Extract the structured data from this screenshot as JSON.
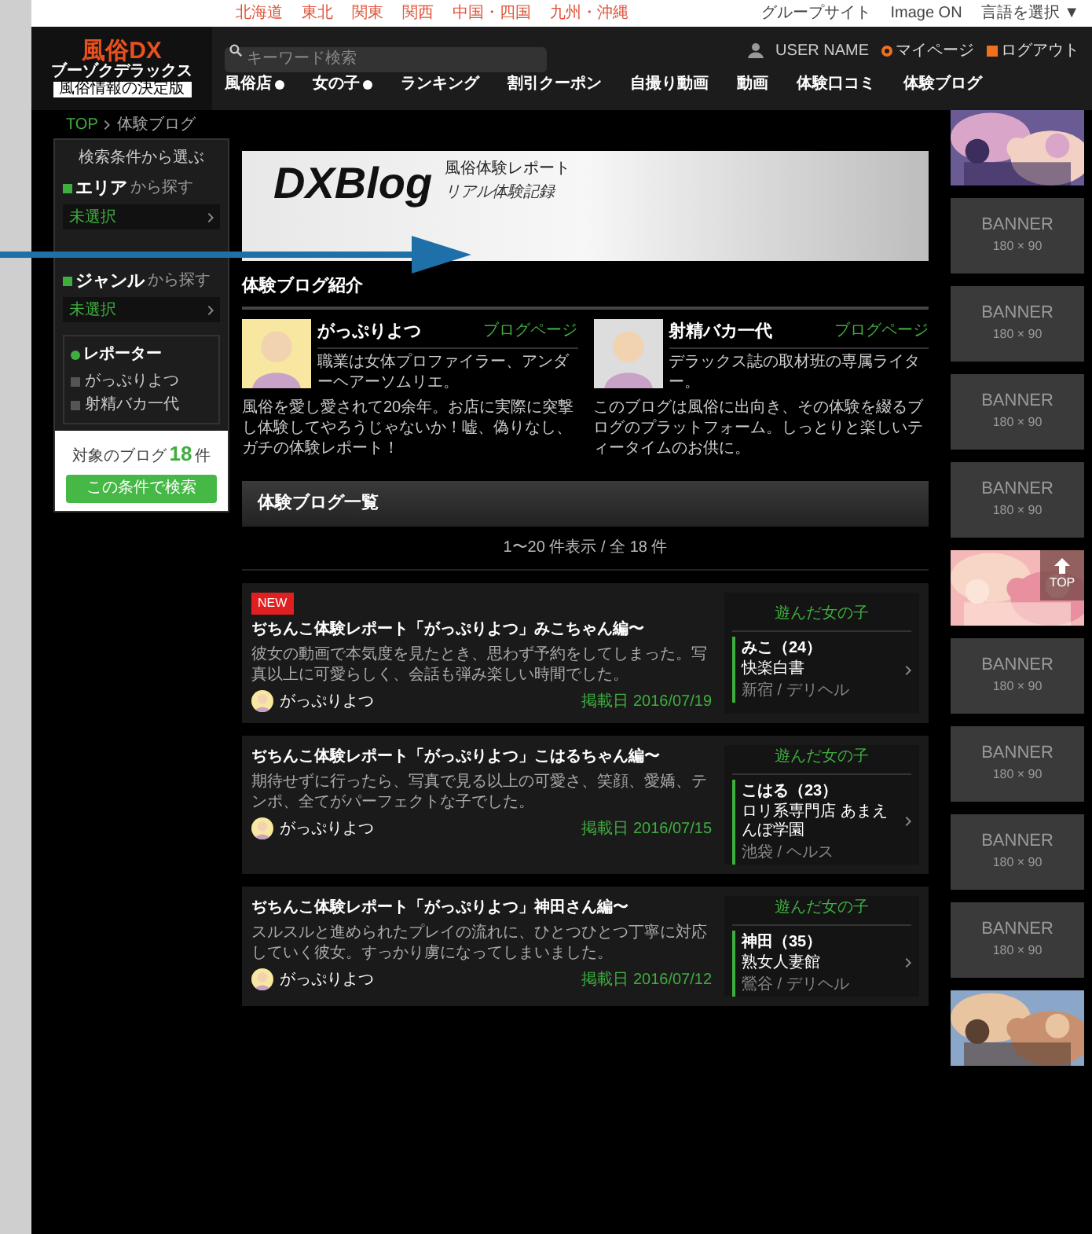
{
  "top_links": [
    "北海道",
    "東北",
    "関東",
    "関西",
    "中国・四国",
    "九州・沖縄"
  ],
  "top_right": [
    "グループサイト",
    "Image ON",
    "言語を選択 ▼"
  ],
  "logo": {
    "main": "風俗DX",
    "sub": "ブーゾクデラックス",
    "tag": "風俗情報の決定版"
  },
  "search": {
    "placeholder": "キーワード検索"
  },
  "user": {
    "name": "USER NAME",
    "links": [
      "マイページ",
      "ログアウト"
    ]
  },
  "nav": [
    {
      "label": "風俗店",
      "badge": true
    },
    {
      "label": "女の子",
      "badge": true
    },
    {
      "label": "ランキング",
      "badge": false
    },
    {
      "label": "割引クーポン",
      "badge": false
    },
    {
      "label": "自撮り動画",
      "badge": false
    },
    {
      "label": "動画",
      "badge": false
    },
    {
      "label": "体験口コミ",
      "badge": false
    },
    {
      "label": "体験ブログ",
      "badge": false
    }
  ],
  "breadcrumb": [
    "TOP",
    "体験ブログ"
  ],
  "sidebar": {
    "title": "検索条件から選ぶ",
    "filters": [
      {
        "label": "エリア",
        "suffix": "から探す",
        "value": "未選択"
      },
      {
        "label": "ジャンル",
        "suffix": "から探す",
        "value": "未選択"
      }
    ],
    "reporter_title": "レポーター",
    "reporters": [
      {
        "label": "がっぷりよつ",
        "checked": false
      },
      {
        "label": "射精バカ一代",
        "checked": false
      }
    ],
    "count_label": "対象のブログ",
    "count": "18",
    "count_unit": "件",
    "button": "この条件で検索"
  },
  "hero": {
    "logo": "DXBlog",
    "subtitle": "風俗体験レポート",
    "tagline": "リアル体験記録"
  },
  "intro": {
    "title": "体験ブログ紹介",
    "reporters": [
      {
        "name": "がっぷりよつ",
        "link": "ブログページ",
        "bio": "職業は女体プロファイラー、アンダーヘアーソムリエ。",
        "text": "風俗を愛し愛されて20余年。お店に実際に突撃し体験してやろうじゃないか！嘘、偽りなし、ガチの体験レポート！"
      },
      {
        "name": "射精バカ一代",
        "link": "ブログページ",
        "bio": "デラックス誌の取材班の専属ライター。",
        "text": "このブログは風俗に出向き、その体験を綴るブログのプラットフォーム。しっとりと楽しいティータイムのお供に。"
      }
    ]
  },
  "list": {
    "title": "体験ブログ一覧",
    "range": "1〜20 件表示 / 全 18 件",
    "posts": [
      {
        "badge": "NEW",
        "title": "ぢちんこ体験レポート「がっぷりよつ」みこちゃん編〜",
        "excerpt": "彼女の動画で本気度を見たとき、思わず予約をしてしまった。写真以上に可愛らしく、会話も弾み楽しい時間でした。",
        "author": "がっぷりよつ",
        "date": "掲載日 2016/07/19",
        "girl_label": "遊んだ女の子",
        "girl": "みこ（24）",
        "shop": "快楽白書",
        "area": "新宿 / デリヘル"
      },
      {
        "title": "ぢちんこ体験レポート「がっぷりよつ」こはるちゃん編〜",
        "excerpt": "期待せずに行ったら、写真で見る以上の可愛さ、笑顔、愛嬌、テンポ、全てがパーフェクトな子でした。",
        "author": "がっぷりよつ",
        "date": "掲載日 2016/07/15",
        "girl_label": "遊んだ女の子",
        "girl": "こはる（23）",
        "shop": "ロリ系専門店 あまえんぼ学園",
        "area": "池袋 / ヘルス"
      },
      {
        "title": "ぢちんこ体験レポート「がっぷりよつ」神田さん編〜",
        "excerpt": "スルスルと進められたプレイの流れに、ひとつひとつ丁寧に対応していく彼女。すっかり虜になってしまいました。",
        "author": "がっぷりよつ",
        "date": "掲載日 2016/07/12",
        "girl_label": "遊んだ女の子",
        "girl": "神田（35）",
        "shop": "熟女人妻館",
        "area": "鶯谷 / デリヘル"
      }
    ]
  },
  "banners": [
    {
      "kind": "picture"
    },
    {
      "kind": "banner",
      "label": "BANNER",
      "size": "180 × 90"
    },
    {
      "kind": "banner",
      "label": "BANNER",
      "size": "180 × 90"
    },
    {
      "kind": "banner",
      "label": "BANNER",
      "size": "180 × 90"
    },
    {
      "kind": "banner",
      "label": "BANNER",
      "size": "180 × 90"
    },
    {
      "kind": "picture",
      "top": "TOP"
    },
    {
      "kind": "banner",
      "label": "BANNER",
      "size": "180 × 90"
    },
    {
      "kind": "banner",
      "label": "BANNER",
      "size": "180 × 90"
    },
    {
      "kind": "banner",
      "label": "BANNER",
      "size": "180 × 90"
    },
    {
      "kind": "banner",
      "label": "BANNER",
      "size": "180 × 90"
    },
    {
      "kind": "picture"
    }
  ]
}
